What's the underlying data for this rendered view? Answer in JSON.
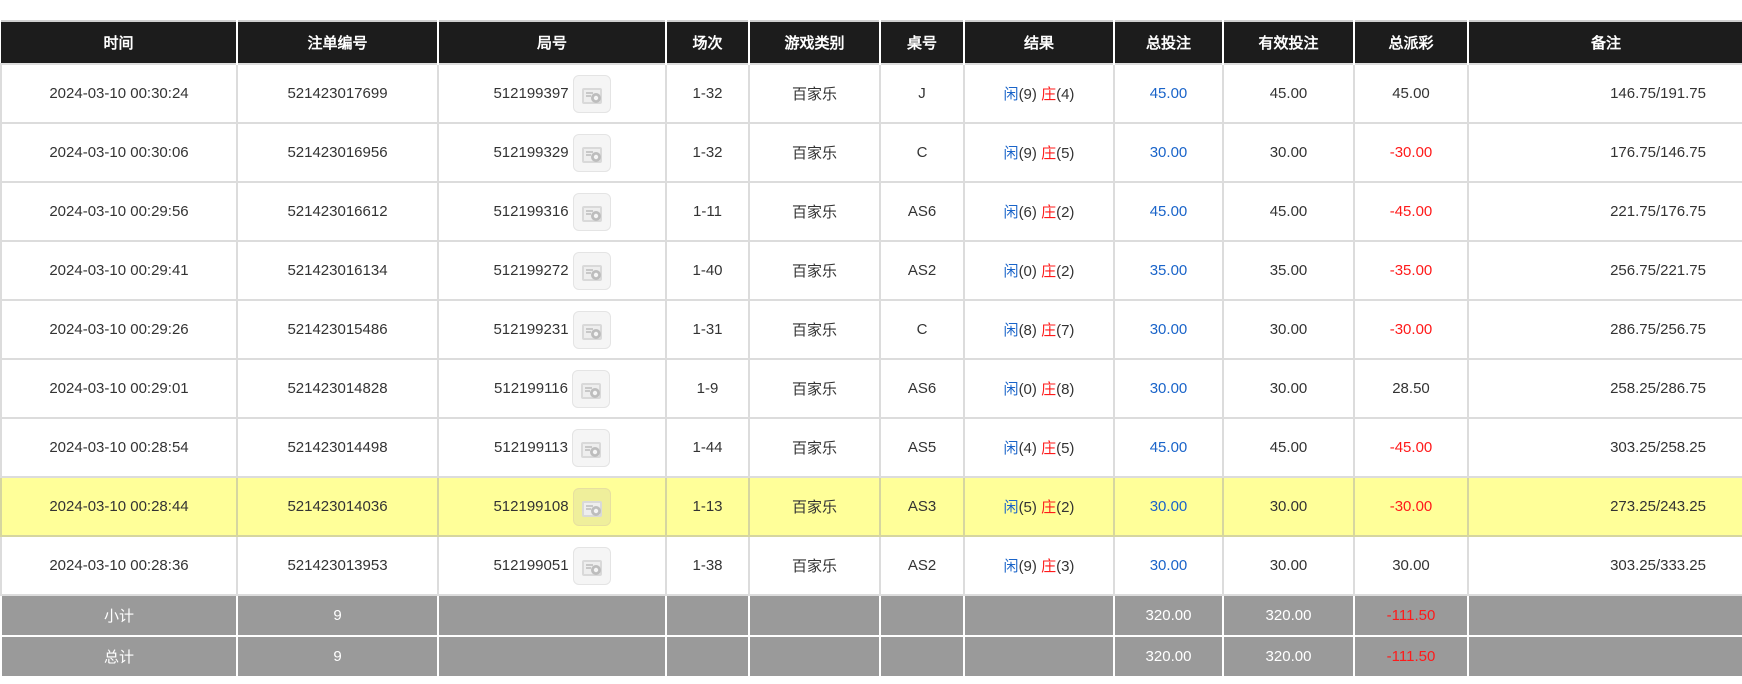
{
  "table": {
    "columns": [
      "时间",
      "注单编号",
      "局号",
      "场次",
      "游戏类别",
      "桌号",
      "结果",
      "总投注",
      "有效投注",
      "总派彩",
      "备注"
    ],
    "rows": [
      {
        "time": "2024-03-10 00:30:24",
        "order_no": "521423017699",
        "round_no": "512199397",
        "session": "1-32",
        "game": "百家乐",
        "table": "J",
        "player_label": "闲",
        "player_score": "(9)",
        "banker_label": "庄",
        "banker_score": "(4)",
        "total_bet": "45.00",
        "valid_bet": "45.00",
        "payout": "45.00",
        "payout_negative": false,
        "remark": "146.75/191.75",
        "highlight": false
      },
      {
        "time": "2024-03-10 00:30:06",
        "order_no": "521423016956",
        "round_no": "512199329",
        "session": "1-32",
        "game": "百家乐",
        "table": "C",
        "player_label": "闲",
        "player_score": "(9)",
        "banker_label": "庄",
        "banker_score": "(5)",
        "total_bet": "30.00",
        "valid_bet": "30.00",
        "payout": "-30.00",
        "payout_negative": true,
        "remark": "176.75/146.75",
        "highlight": false
      },
      {
        "time": "2024-03-10 00:29:56",
        "order_no": "521423016612",
        "round_no": "512199316",
        "session": "1-11",
        "game": "百家乐",
        "table": "AS6",
        "player_label": "闲",
        "player_score": "(6)",
        "banker_label": "庄",
        "banker_score": "(2)",
        "total_bet": "45.00",
        "valid_bet": "45.00",
        "payout": "-45.00",
        "payout_negative": true,
        "remark": "221.75/176.75",
        "highlight": false
      },
      {
        "time": "2024-03-10 00:29:41",
        "order_no": "521423016134",
        "round_no": "512199272",
        "session": "1-40",
        "game": "百家乐",
        "table": "AS2",
        "player_label": "闲",
        "player_score": "(0)",
        "banker_label": "庄",
        "banker_score": "(2)",
        "total_bet": "35.00",
        "valid_bet": "35.00",
        "payout": "-35.00",
        "payout_negative": true,
        "remark": "256.75/221.75",
        "highlight": false
      },
      {
        "time": "2024-03-10 00:29:26",
        "order_no": "521423015486",
        "round_no": "512199231",
        "session": "1-31",
        "game": "百家乐",
        "table": "C",
        "player_label": "闲",
        "player_score": "(8)",
        "banker_label": "庄",
        "banker_score": "(7)",
        "total_bet": "30.00",
        "valid_bet": "30.00",
        "payout": "-30.00",
        "payout_negative": true,
        "remark": "286.75/256.75",
        "highlight": false
      },
      {
        "time": "2024-03-10 00:29:01",
        "order_no": "521423014828",
        "round_no": "512199116",
        "session": "1-9",
        "game": "百家乐",
        "table": "AS6",
        "player_label": "闲",
        "player_score": "(0)",
        "banker_label": "庄",
        "banker_score": "(8)",
        "total_bet": "30.00",
        "valid_bet": "30.00",
        "payout": "28.50",
        "payout_negative": false,
        "remark": "258.25/286.75",
        "highlight": false
      },
      {
        "time": "2024-03-10 00:28:54",
        "order_no": "521423014498",
        "round_no": "512199113",
        "session": "1-44",
        "game": "百家乐",
        "table": "AS5",
        "player_label": "闲",
        "player_score": "(4)",
        "banker_label": "庄",
        "banker_score": "(5)",
        "total_bet": "45.00",
        "valid_bet": "45.00",
        "payout": "-45.00",
        "payout_negative": true,
        "remark": "303.25/258.25",
        "highlight": false
      },
      {
        "time": "2024-03-10 00:28:44",
        "order_no": "521423014036",
        "round_no": "512199108",
        "session": "1-13",
        "game": "百家乐",
        "table": "AS3",
        "player_label": "闲",
        "player_score": "(5)",
        "banker_label": "庄",
        "banker_score": "(2)",
        "total_bet": "30.00",
        "valid_bet": "30.00",
        "payout": "-30.00",
        "payout_negative": true,
        "remark": "273.25/243.25",
        "highlight": true
      },
      {
        "time": "2024-03-10 00:28:36",
        "order_no": "521423013953",
        "round_no": "512199051",
        "session": "1-38",
        "game": "百家乐",
        "table": "AS2",
        "player_label": "闲",
        "player_score": "(9)",
        "banker_label": "庄",
        "banker_score": "(3)",
        "total_bet": "30.00",
        "valid_bet": "30.00",
        "payout": "30.00",
        "payout_negative": false,
        "remark": "303.25/333.25",
        "highlight": false
      }
    ],
    "subtotal": {
      "label": "小计",
      "count": "9",
      "total_bet": "320.00",
      "valid_bet": "320.00",
      "payout": "-111.50"
    },
    "grandtotal": {
      "label": "总计",
      "count": "9",
      "total_bet": "320.00",
      "valid_bet": "320.00",
      "payout": "-111.50"
    }
  },
  "colors": {
    "header_bg": "#1c1c1c",
    "footer_bg": "#9a9a9a",
    "highlight_row": "#ffff99",
    "blue_text": "#1a64c9",
    "red_text": "#ff1a1a"
  },
  "icons": {
    "round_detail": "gift-icon"
  }
}
